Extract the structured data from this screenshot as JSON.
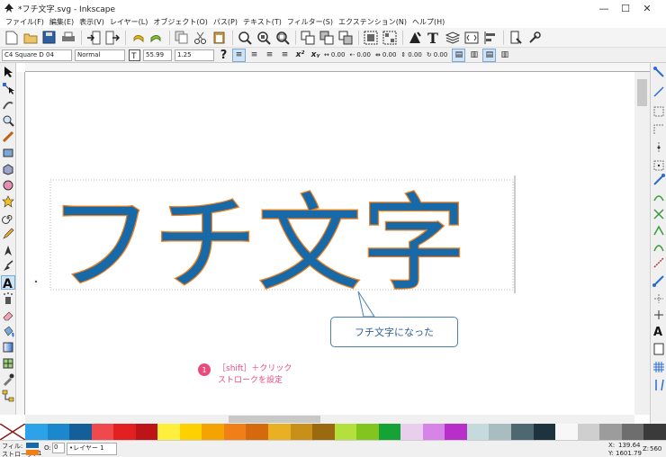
{
  "window": {
    "title": "*フチ文字.svg - Inkscape",
    "minimize": "—",
    "maximize": "☐",
    "close": "✕"
  },
  "menu": [
    "ファイル(F)",
    "編集(E)",
    "表示(V)",
    "レイヤー(L)",
    "オブジェクト(O)",
    "パス(P)",
    "テキスト(T)",
    "フィルター(S)",
    "エクステンション(N)",
    "ヘルプ(H)"
  ],
  "textbar": {
    "font_family": "C4 Square D 04",
    "font_style": "Normal",
    "font_size": "55.99",
    "line_spacing": "1.25",
    "letter_spacing": "0.00",
    "word_spacing": "0.00",
    "kerning": "0.00",
    "vertical_shift": "0.00",
    "rotation": "0.00"
  },
  "canvas": {
    "main_text": "フチ文字",
    "text_fill": "#1769a8",
    "text_stroke": "#f07f1a"
  },
  "callout": {
    "text": "フチ文字になった"
  },
  "annotation": {
    "number": "1",
    "line1": "［shift］＋クリック",
    "line2": "ストロークを設定"
  },
  "palette": [
    "#2ca3e8",
    "#1b87cc",
    "#145f9a",
    "#f0494d",
    "#e22021",
    "#bd1419",
    "#ffef3d",
    "#fdd000",
    "#f5a300",
    "#f07f1a",
    "#d5690e",
    "#e9b023",
    "#c8901b",
    "#9c6a0e",
    "#b4e03d",
    "#83c51f",
    "#14a334",
    "#e9ceee",
    "#d684e6",
    "#b82ec8",
    "#c6dadd",
    "#a9bdc0",
    "#4d6870",
    "#1d3340",
    "#f7f7f7",
    "#cfcfcf",
    "#9c9c9c",
    "#6e6e6e",
    "#3a3a3a"
  ],
  "status": {
    "fill_label": "フィル:",
    "stroke_label": "ストローク:",
    "stroke_width": "1",
    "opacity": "O:",
    "opacity_value": "0",
    "layer": "•レイヤー 1",
    "x_label": "X:",
    "x_value": "139.64",
    "y_label": "Y:",
    "y_value": "1601.79",
    "zoom_label": "Z:",
    "zoom_value": "560",
    "zoom_unit": "%"
  }
}
